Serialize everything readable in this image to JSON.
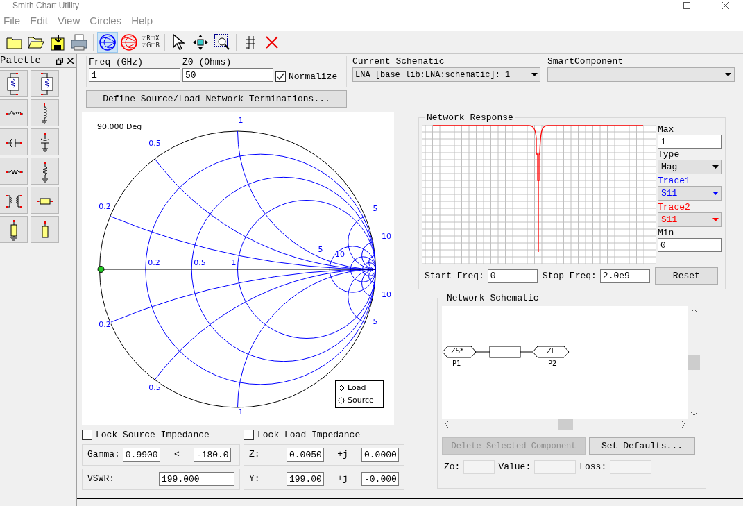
{
  "window": {
    "title": "Smith Chart Utility"
  },
  "menu": [
    "File",
    "Edit",
    "View",
    "Circles",
    "Help"
  ],
  "toolbar": {
    "chart_buttons": [
      {
        "selected": true
      },
      {
        "selected": false
      }
    ],
    "toggle_rows": [
      "☑R☐X",
      "☑G☐B"
    ]
  },
  "palette": {
    "title": "Palette"
  },
  "settings": {
    "freq_label": "Freq (GHz)",
    "freq": "1",
    "z0_label": "Z0 (Ohms)",
    "z0": "50",
    "normalize": {
      "label": "Normalize",
      "checked": true
    }
  },
  "current_schematic": {
    "label": "Current Schematic",
    "value": "LNA [base_lib:LNA:schematic]: 1"
  },
  "smart_component": {
    "label": "SmartComponent"
  },
  "define_button": "Define Source/Load Network Terminations...",
  "smith_chart": {
    "angle": "90.000 Deg",
    "labels": [
      "1",
      "0.5",
      "0.2",
      "5",
      "10",
      "0.2",
      "0.5",
      "1",
      "5",
      "10",
      "10",
      "5",
      "0.2",
      "0.5",
      "1"
    ],
    "legend": [
      "Load",
      "Source"
    ]
  },
  "locks": [
    {
      "label": "Lock Source Impedance",
      "checked": false
    },
    {
      "label": "Lock Load Impedance",
      "checked": false
    }
  ],
  "gamma": {
    "label": "Gamma:",
    "magnitude": "0.9900",
    "angle_sign": "<",
    "angle": "-180.0"
  },
  "z": {
    "label": "Z:",
    "real": "0.0050",
    "j": "+j",
    "imag": "0.0000"
  },
  "vswr": {
    "label": "VSWR:",
    "value": "199.000"
  },
  "y": {
    "label": "Y:",
    "real": "199.00",
    "j": "+j",
    "imag": "-0.000"
  },
  "network_response": {
    "title": "Network Response",
    "max_label": "Max",
    "max": "1",
    "type_label": "Type",
    "type": "Mag",
    "traces": [
      {
        "label": "Trace1",
        "value": "S11",
        "color": "#0000ff"
      },
      {
        "label": "Trace2",
        "value": "S11",
        "color": "#ff0000"
      }
    ],
    "min_label": "Min",
    "min": "0",
    "start_label": "Start Freq:",
    "start": "0",
    "stop_label": "Stop Freq:",
    "stop": "2.0e9",
    "reset": "Reset"
  },
  "network_schematic": {
    "title": "Network Schematic",
    "ports": [
      {
        "symbol": "ZS*",
        "name": "P1"
      },
      {
        "symbol": "ZL",
        "name": "P2"
      }
    ],
    "delete_button": {
      "label": "Delete Selected Component",
      "disabled": true
    },
    "defaults_button": "Set Defaults...",
    "fields": [
      "Zo:",
      "Value:",
      "Loss:"
    ]
  }
}
